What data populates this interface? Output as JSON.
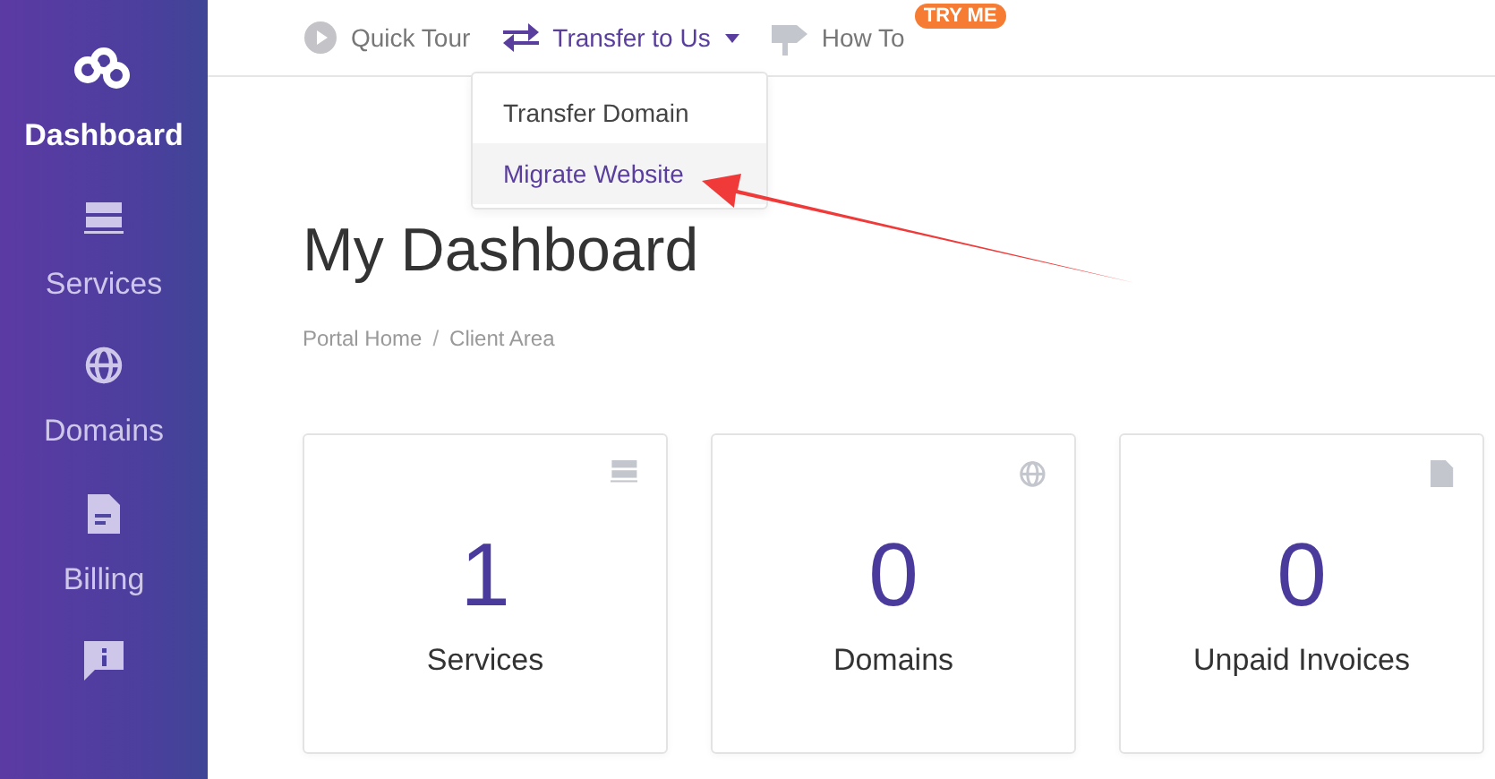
{
  "sidebar": {
    "items": [
      {
        "kind": "logo",
        "label": "Dashboard",
        "selected": true
      },
      {
        "kind": "services",
        "label": "Services",
        "selected": false
      },
      {
        "kind": "domains",
        "label": "Domains",
        "selected": false
      },
      {
        "kind": "billing",
        "label": "Billing",
        "selected": false
      },
      {
        "kind": "support",
        "selected": false
      }
    ]
  },
  "topnav": [
    {
      "kind": "play",
      "label": "Quick Tour",
      "active": false
    },
    {
      "kind": "transfer",
      "label": "Transfer to Us",
      "active": true,
      "dropdown": true
    },
    {
      "kind": "sign",
      "label": "How To",
      "active": false,
      "badge": "TRY ME"
    }
  ],
  "dropdown": {
    "items": [
      {
        "label": "Transfer Domain",
        "selected": false
      },
      {
        "label": "Migrate Website",
        "selected": true
      }
    ]
  },
  "page_title": "My Dashboard",
  "breadcrumb": [
    {
      "label": "Portal Home",
      "separator": "/"
    },
    {
      "label": "Client Area"
    }
  ],
  "tiles": [
    {
      "kind": "services",
      "count": "1",
      "label": "Services"
    },
    {
      "kind": "domains",
      "count": "0",
      "label": "Domains"
    },
    {
      "kind": "billing",
      "count": "0",
      "label": "Unpaid Invoices"
    }
  ]
}
